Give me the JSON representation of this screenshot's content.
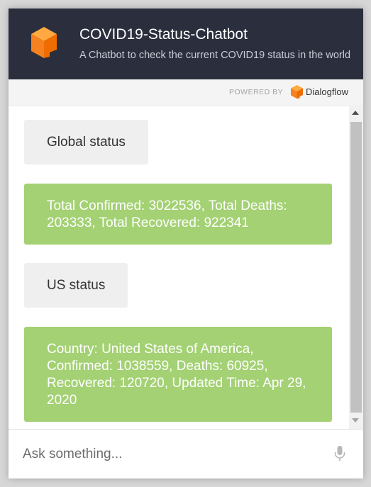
{
  "header": {
    "title": "COVID19-Status-Chatbot",
    "subtitle": "A Chatbot to check the current COVID19 status in the world",
    "logo_icon": "dialogflow-cube-icon"
  },
  "powered_by": {
    "label": "POWERED BY",
    "brand": "Dialogflow",
    "brand_icon": "dialogflow-logo-icon"
  },
  "messages": [
    {
      "from": "user",
      "text": "Global status"
    },
    {
      "from": "bot",
      "text": "Total Confirmed: 3022536, Total Deaths: 203333, Total Recovered: 922341"
    },
    {
      "from": "user",
      "text": "US status"
    },
    {
      "from": "bot",
      "text": "Country: United States of America, Confirmed: 1038559, Deaths: 60925, Recovered: 120720, Updated Time: Apr 29, 2020"
    }
  ],
  "input": {
    "placeholder": "Ask something...",
    "value": "",
    "mic_icon": "microphone-icon"
  },
  "colors": {
    "header_bg": "#2b2f3d",
    "bot_bubble": "#a3d173",
    "user_bubble": "#efefef",
    "brand_orange": "#f5821f"
  }
}
